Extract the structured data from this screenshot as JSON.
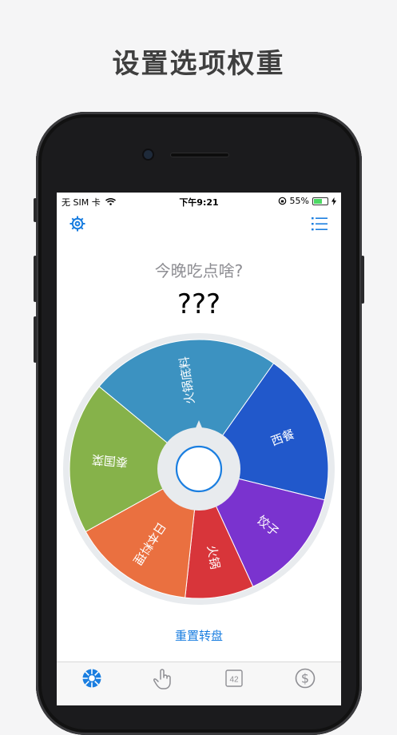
{
  "promo_title": "设置选项权重",
  "status_bar": {
    "carrier": "无 SIM 卡",
    "time": "下午9:21",
    "battery_percent": "55%",
    "battery_level": 0.55
  },
  "header": {
    "settings_icon": "gear-icon",
    "list_icon": "list-icon"
  },
  "main": {
    "question": "今晚吃点啥?",
    "result": "???"
  },
  "wheel": {
    "segments": [
      {
        "label": "泰国菜",
        "weight": 2,
        "color": "#86b24a"
      },
      {
        "label": "火锅底料",
        "weight": 2.5,
        "color": "#3c92c1"
      },
      {
        "label": "西餐",
        "weight": 2,
        "color": "#2158cb"
      },
      {
        "label": "饺子",
        "weight": 1.5,
        "color": "#7a33cf"
      },
      {
        "label": "火锅",
        "weight": 0.9,
        "color": "#d8353a"
      },
      {
        "label": "日本料理",
        "weight": 1.6,
        "color": "#ea7040"
      }
    ]
  },
  "reset_label": "重置转盘",
  "tabbar": {
    "tabs": [
      {
        "icon": "wheel-icon",
        "active": true
      },
      {
        "icon": "tap-icon",
        "active": false
      },
      {
        "icon": "number-icon",
        "text": "42",
        "active": false
      },
      {
        "icon": "dollar-icon",
        "active": false
      }
    ]
  },
  "colors": {
    "accent": "#1a7ee0",
    "pointer": "#e8ebee"
  }
}
